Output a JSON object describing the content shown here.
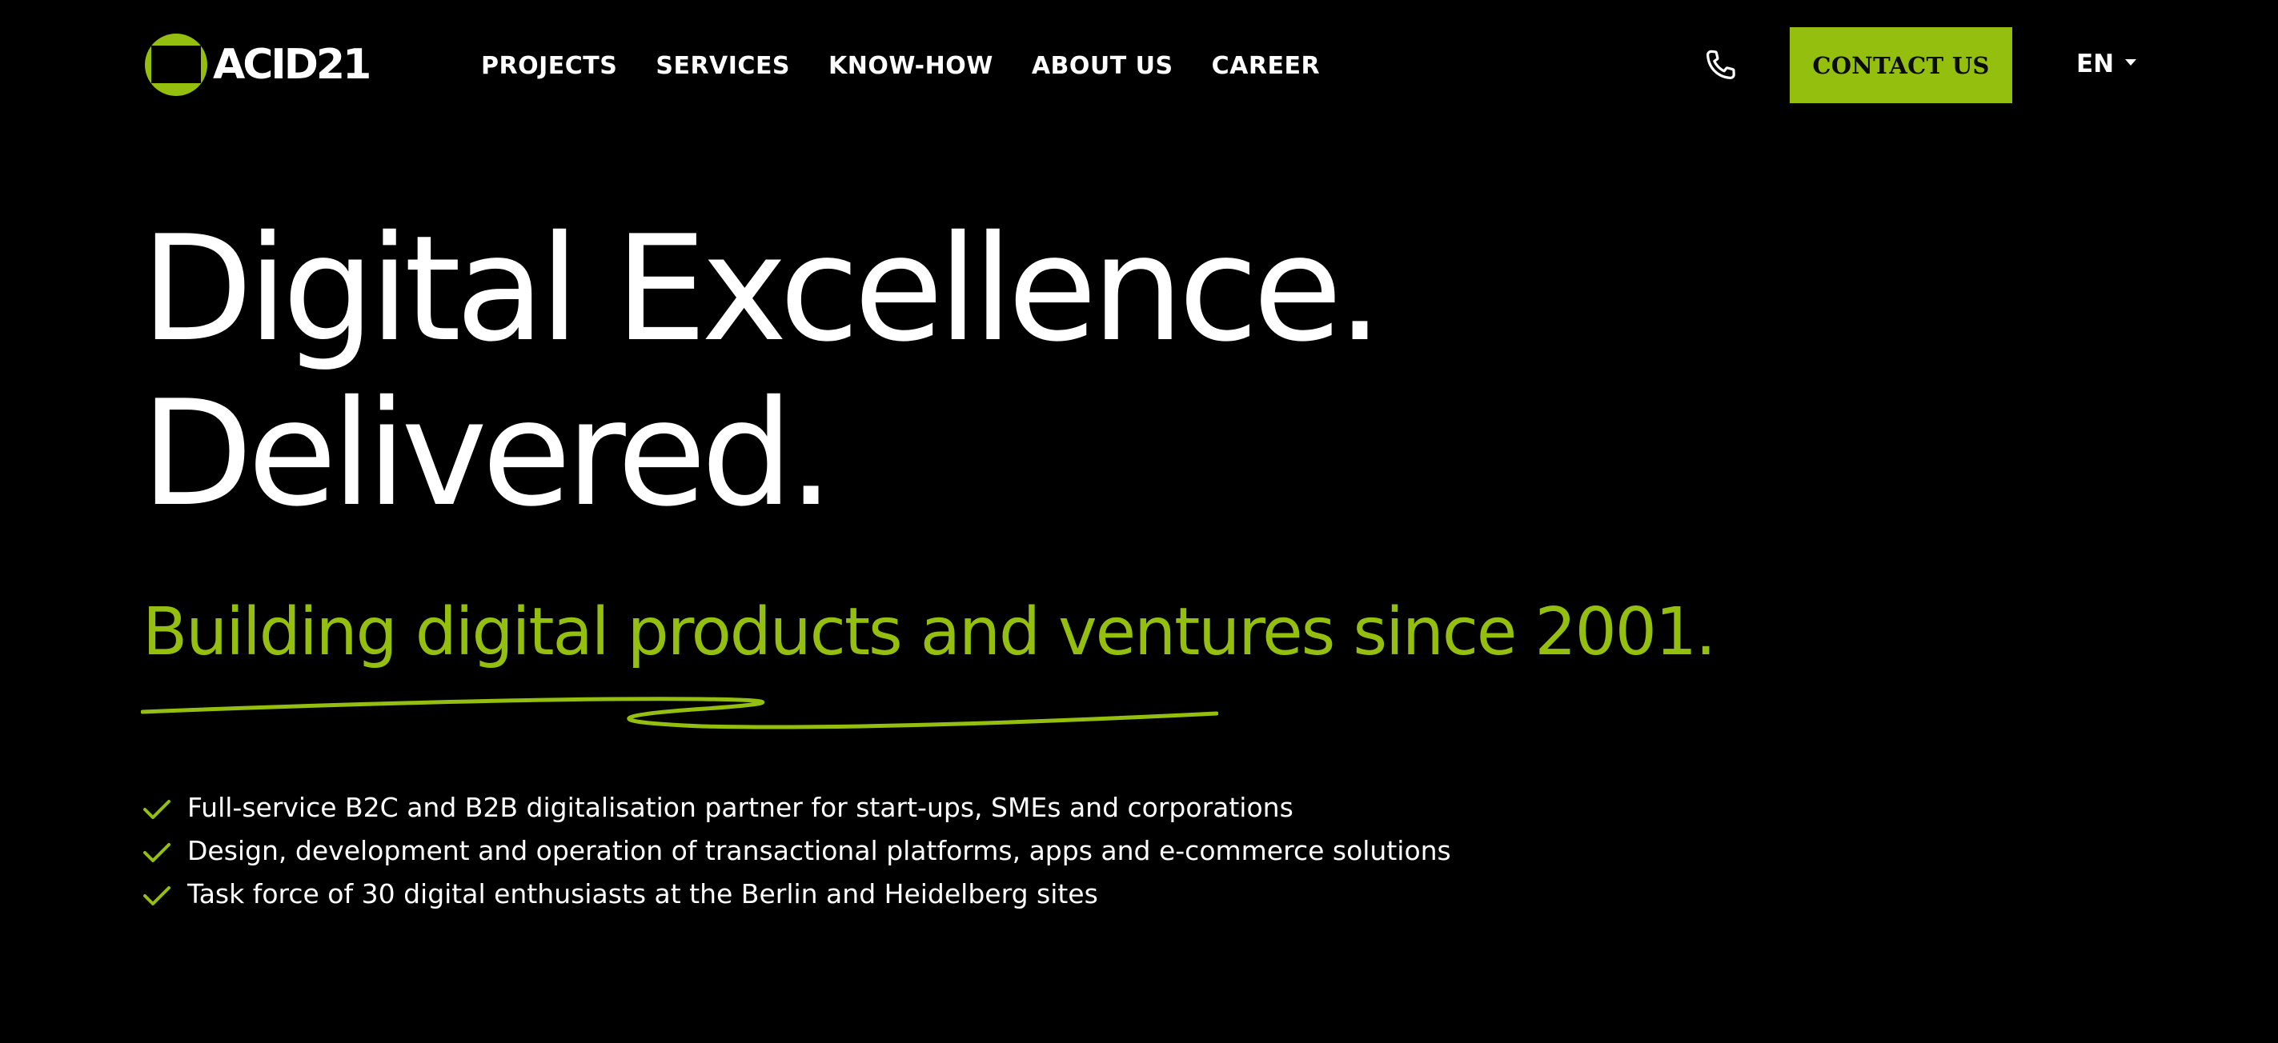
{
  "brand": {
    "name": "ACID21",
    "accent_color": "#95bf0e",
    "background_color": "#000000",
    "text_color": "#ffffff",
    "logo_icon": "acid21-logo-icon"
  },
  "nav": {
    "items": [
      {
        "label": "PROJECTS"
      },
      {
        "label": "SERVICES"
      },
      {
        "label": "KNOW-HOW"
      },
      {
        "label": "ABOUT US"
      },
      {
        "label": "CAREER"
      }
    ]
  },
  "header": {
    "phone_icon": "phone-icon",
    "contact_label": "CONTACT US",
    "language": "EN",
    "language_caret_icon": "caret-down-icon"
  },
  "hero": {
    "title_line1": "Digital Excellence.",
    "title_line2": "Delivered.",
    "subtitle": "Building digital products and ventures since 2001.",
    "underline_decoration": "squiggle-underline"
  },
  "features": {
    "check_icon": "check-icon",
    "items": [
      "Full-service B2C and B2B digitalisation partner for start-ups, SMEs and corporations",
      "Design, development and operation of transactional platforms, apps and e-commerce solutions",
      "Task force of 30 digital enthusiasts at the Berlin and Heidelberg sites"
    ]
  }
}
